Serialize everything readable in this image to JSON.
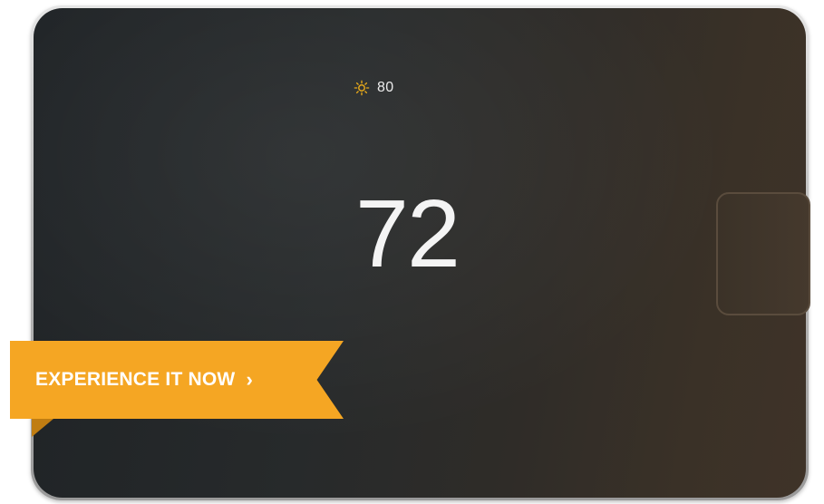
{
  "outdoor": {
    "icon": "sun-icon",
    "temperature": "80",
    "icon_color": "#e7a91a"
  },
  "thermostat": {
    "setpoint": "72"
  },
  "banner": {
    "label": "EXPERIENCE IT NOW",
    "chevron": "›",
    "color": "#f5a623"
  }
}
